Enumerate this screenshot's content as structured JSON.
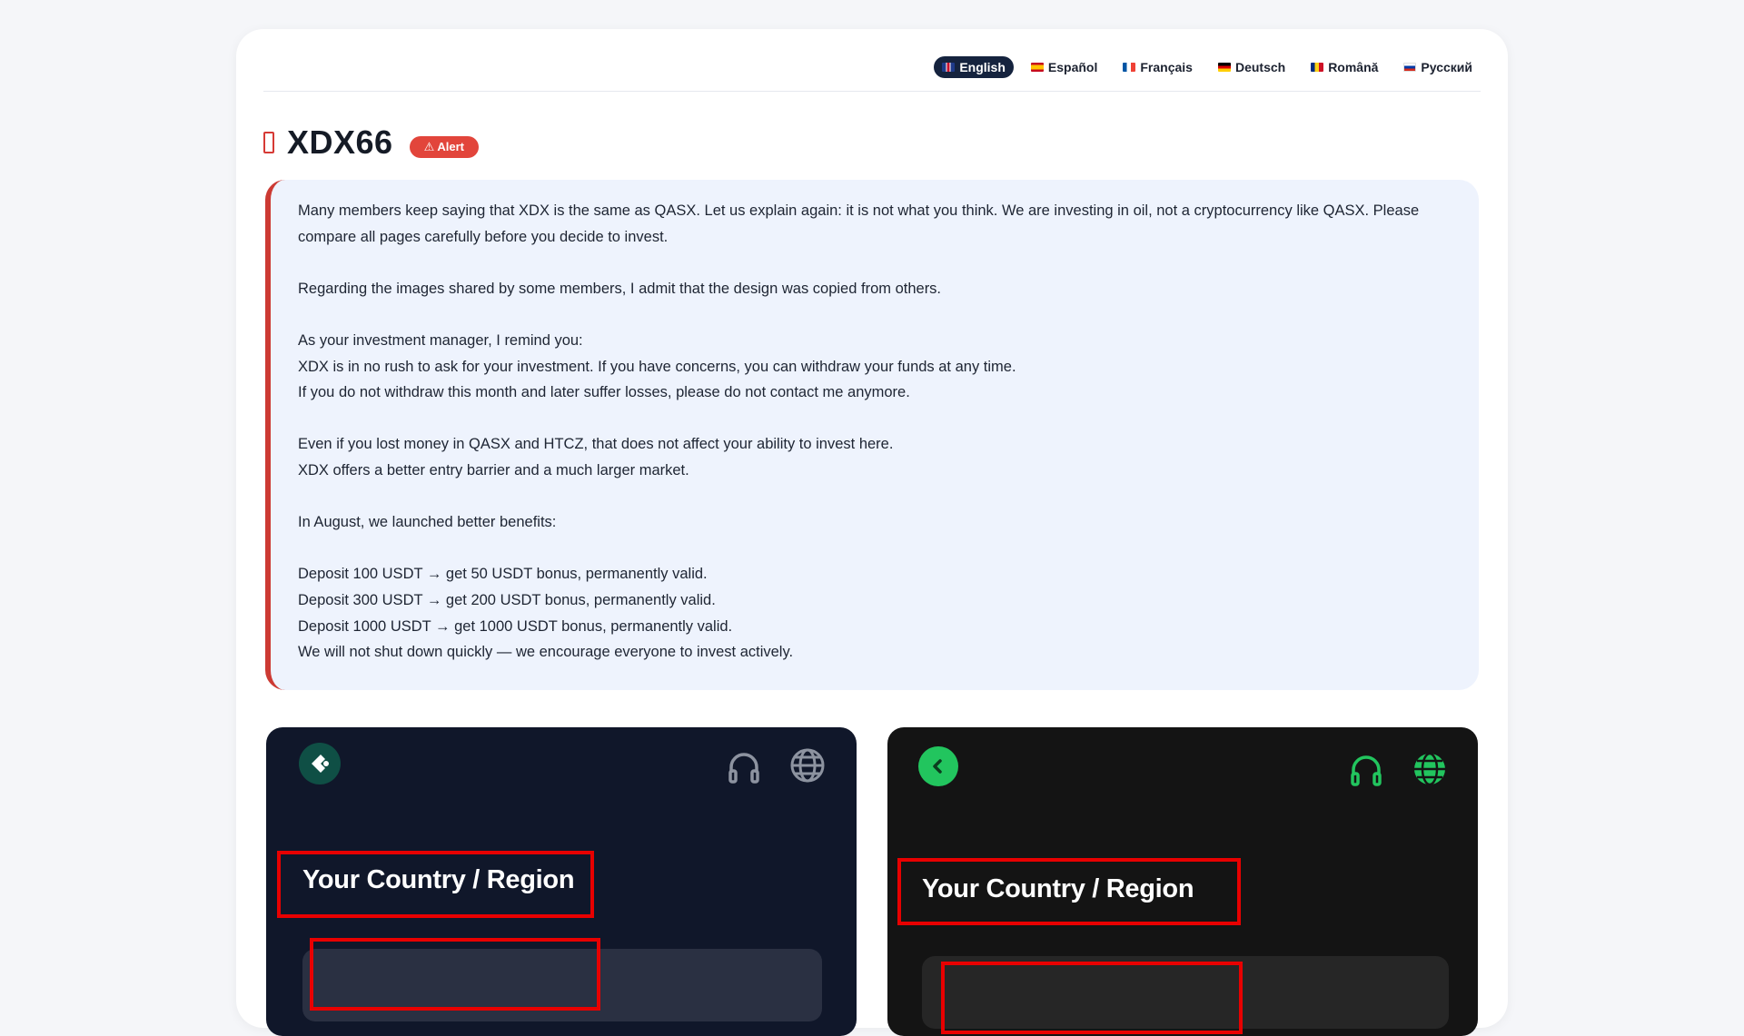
{
  "languages": [
    {
      "label": "English",
      "flag": "uk-flag-icon",
      "active": true
    },
    {
      "label": "Español",
      "flag": "spain-flag-icon",
      "active": false
    },
    {
      "label": "Français",
      "flag": "france-flag-icon",
      "active": false
    },
    {
      "label": "Deutsch",
      "flag": "germany-flag-icon",
      "active": false
    },
    {
      "label": "Română",
      "flag": "romania-flag-icon",
      "active": false
    },
    {
      "label": "Русский",
      "flag": "russia-flag-icon",
      "active": false
    }
  ],
  "header": {
    "title": "XDX66",
    "badge": "⚠ Alert"
  },
  "alert": {
    "paragraphs": [
      [
        "Many members keep saying that XDX is the same as QASX. Let us explain again: it is not what you think. We are investing in oil, not a cryptocurrency like QASX. Please compare all pages carefully before you decide to invest."
      ],
      [
        "Regarding the images shared by some members, I admit that the design was copied from others."
      ],
      [
        "As your investment manager, I remind you:",
        "XDX is in no rush to ask for your investment. If you have concerns, you can withdraw your funds at any time.",
        "If you do not withdraw this month and later suffer losses, please do not contact me anymore."
      ],
      [
        "Even if you lost money in QASX and HTCZ, that does not affect your ability to invest here.",
        "XDX offers a better entry barrier and a much larger market."
      ],
      [
        "In August, we launched better benefits:"
      ],
      [
        "Deposit 100 USDT → get 50 USDT bonus, permanently valid.",
        "Deposit 300 USDT → get 200 USDT bonus, permanently valid.",
        "Deposit 1000 USDT → get 1000 USDT bonus, permanently valid.",
        "We will not shut down quickly — we encourage everyone to invest actively."
      ]
    ]
  },
  "screenshots": {
    "left": {
      "region_title": "Your Country / Region",
      "highlight_color": "#e80000"
    },
    "right": {
      "region_title": "Your Country / Region",
      "highlight_color": "#e80000",
      "accent": "#22c55e"
    }
  },
  "colors": {
    "accent_red": "#e2453b",
    "active_lang_bg": "#15233e",
    "alert_bg": "#eef3fd"
  }
}
